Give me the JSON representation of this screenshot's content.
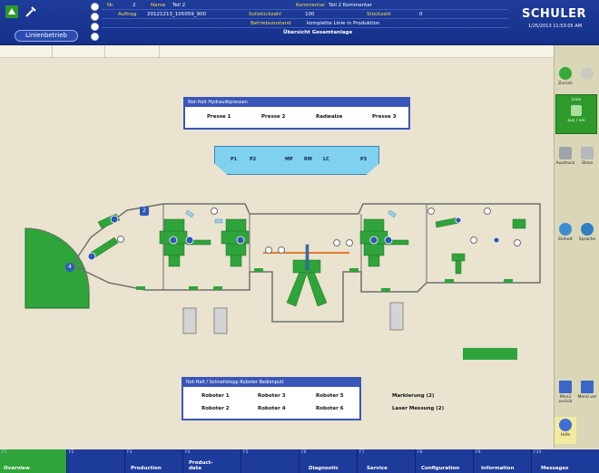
{
  "header": {
    "mode_label": "Linienbetrieb",
    "fields": [
      {
        "label": "Nr.",
        "value": "2"
      },
      {
        "label": "Name",
        "value": "Teil 2"
      },
      {
        "label": "Kommentar",
        "value": "Teil 2 Kommentar"
      },
      {
        "label": "Auftrag",
        "value": "20121213_105059_900"
      },
      {
        "label": "Sollstückzahl",
        "value": "100"
      },
      {
        "label": "Stückzahl",
        "value": "0"
      },
      {
        "label": "Betriebszustand",
        "value": "komplette Linie in Produktion"
      },
      {
        "label": "",
        "value": "Übersicht Gesamtanlage"
      }
    ],
    "logo": "SCHULER",
    "datetime": "1/25/2013 11:53:05 AM"
  },
  "right_panel": {
    "back": "Zurück",
    "forward": "",
    "green_top": "Linie",
    "green_bottom": "aus / ein",
    "print": "Ausdruck",
    "print2": "Strea",
    "units": "Einheit",
    "language": "Sprache",
    "menu_back": "Menü zurück",
    "menu_fwd": "Menü vor",
    "help": "Hilfe"
  },
  "hydraulic_panel": {
    "title": "Not-Halt Hydraulikpressen",
    "items": [
      "Presse 1",
      "Presse 2",
      "Radwalze",
      "Presse 3"
    ]
  },
  "stations": [
    "P1",
    "P2",
    "MP",
    "RM",
    "LC",
    "P3"
  ],
  "robot_panel": {
    "title": "Not-Halt / Schnellstopp Roboter Bedienpult",
    "items": [
      "Roboter 1",
      "Roboter 3",
      "Roboter 5",
      "Roboter 2",
      "Roboter 4",
      "Roboter 6"
    ]
  },
  "side_labels": [
    "Markierung (2)",
    "Laser Messung (2)"
  ],
  "markers": {
    "m2": "2",
    "m4": "4"
  },
  "function_keys": [
    {
      "key": "F1",
      "label": "Overview",
      "active": true
    },
    {
      "key": "F2",
      "label": ""
    },
    {
      "key": "F3",
      "label": "Production"
    },
    {
      "key": "F4",
      "label": "Product-\ndata"
    },
    {
      "key": "F5",
      "label": ""
    },
    {
      "key": "F6",
      "label": "Diagnostic"
    },
    {
      "key": "F7",
      "label": "Service"
    },
    {
      "key": "F8",
      "label": "Configuration"
    },
    {
      "key": "F9",
      "label": "Information"
    },
    {
      "key": "F10",
      "label": "Messages"
    }
  ],
  "colors": {
    "header_blue": "#1f3d9a",
    "machine_green": "#2ea43a",
    "background": "#e9e3cf"
  }
}
